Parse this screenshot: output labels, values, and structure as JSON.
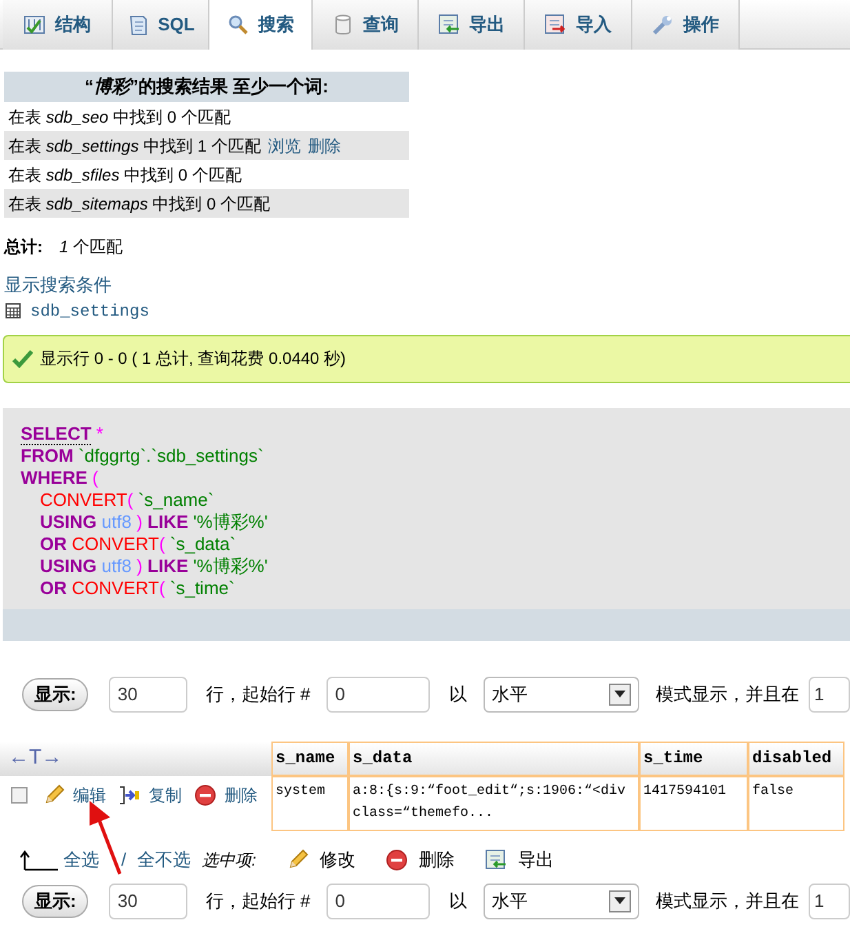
{
  "tabs": [
    {
      "label": "结构",
      "selected": false
    },
    {
      "label": "SQL",
      "selected": false
    },
    {
      "label": "搜索",
      "selected": true
    },
    {
      "label": "查询",
      "selected": false
    },
    {
      "label": "导出",
      "selected": false
    },
    {
      "label": "导入",
      "selected": false
    },
    {
      "label": "操作",
      "selected": false
    }
  ],
  "search_results": {
    "title": "“*博彩*”的搜索结果 至少一个词:",
    "rows": [
      {
        "text": "在表 *sdb_seo* 中找到 0 个匹配",
        "links": []
      },
      {
        "text": "在表 *sdb_settings* 中找到 1 个匹配",
        "links": [
          "浏览",
          "删除"
        ]
      },
      {
        "text": "在表 *sdb_sfiles* 中找到 0 个匹配",
        "links": []
      },
      {
        "text": "在表 *sdb_sitemaps* 中找到 0 个匹配",
        "links": []
      }
    ],
    "total_label": "总计:",
    "total_value": "*1* 个匹配",
    "criteria_link": "显示搜索条件",
    "table_link": "sdb_settings"
  },
  "message": "显示行 0 - 0 ( 1 总计, 查询花费 0.0440 秒)",
  "sql": [
    [
      {
        "kind": "keyword",
        "text": "SELECT"
      },
      {
        "kind": "punct",
        "text": " *"
      }
    ],
    [
      {
        "kind": "keyword",
        "text": "FROM"
      },
      {
        "kind": "string",
        "text": " `dfggrtg`.`sdb_settings`"
      }
    ],
    [
      {
        "kind": "keyword",
        "text": "WHERE"
      },
      {
        "kind": "punct",
        "text": " ("
      }
    ],
    [
      {
        "kind": "function",
        "text": "CONVERT"
      },
      {
        "kind": "punct",
        "text": "( "
      },
      {
        "kind": "string",
        "text": "`s_name`"
      }
    ],
    [
      {
        "kind": "keyword",
        "text": "USING"
      },
      {
        "kind": "charset",
        "text": " utf8"
      },
      {
        "kind": "punct",
        "text": " ) "
      },
      {
        "kind": "keyword",
        "text": "LIKE"
      },
      {
        "kind": "string",
        "text": " '%博彩%'"
      }
    ],
    [
      {
        "kind": "keyword",
        "text": "OR"
      },
      {
        "kind": "function",
        "text": " CONVERT"
      },
      {
        "kind": "punct",
        "text": "( "
      },
      {
        "kind": "string",
        "text": "`s_data`"
      }
    ],
    [
      {
        "kind": "keyword",
        "text": "USING"
      },
      {
        "kind": "charset",
        "text": " utf8"
      },
      {
        "kind": "punct",
        "text": " ) "
      },
      {
        "kind": "keyword",
        "text": "LIKE"
      },
      {
        "kind": "string",
        "text": " '%博彩%'"
      }
    ],
    [
      {
        "kind": "keyword",
        "text": "OR"
      },
      {
        "kind": "function",
        "text": " CONVERT"
      },
      {
        "kind": "punct",
        "text": "( "
      },
      {
        "kind": "string",
        "text": "`s_time`"
      }
    ]
  ],
  "nav_top": {
    "button": "显示:",
    "rows": "30",
    "rows_label": "行，起始行 #",
    "start": "0",
    "mode_label": "以",
    "mode": "水平",
    "after_label": "模式显示，并且在",
    "repeat": "1"
  },
  "grid": {
    "sort_arrows": "←T→",
    "columns": [
      "s_name",
      "s_data",
      "s_time",
      "disabled"
    ],
    "rows": [
      {
        "checked": false,
        "actions": [
          "编辑",
          "复制",
          "删除"
        ],
        "cells": [
          "system",
          "a:8:{s:9:“foot_edit“;s:1906:“<div class=“themefo...",
          "1417594101",
          "false"
        ]
      }
    ]
  },
  "bulk": {
    "check_all": "全选",
    "separator": "/",
    "uncheck_all": "全不选",
    "with_selected": "选中项:",
    "actions": [
      "修改",
      "删除",
      "导出"
    ]
  },
  "nav_bottom": {
    "button": "显示:",
    "rows": "30",
    "rows_label": "行，起始行 #",
    "start": "0",
    "mode_label": "以",
    "mode": "水平",
    "after_label": "模式显示，并且在",
    "repeat": "1"
  }
}
